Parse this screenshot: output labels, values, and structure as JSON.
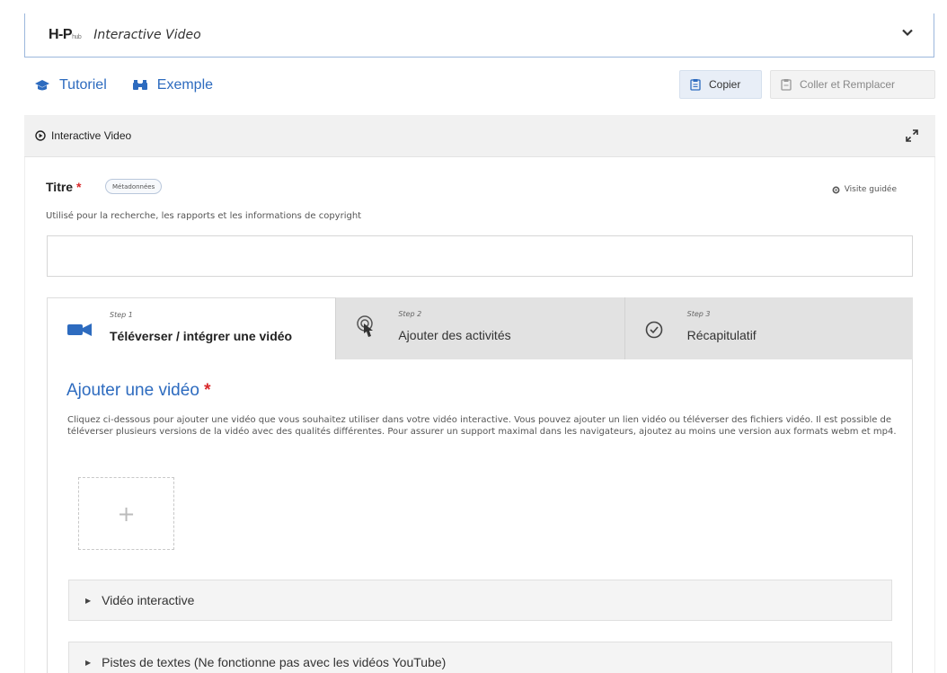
{
  "library": {
    "logo_main": "H-P",
    "logo_sub": "hub",
    "name": "Interactive Video"
  },
  "links": {
    "tutorial": "Tutoriel",
    "example": "Exemple"
  },
  "toolbar": {
    "copy_label": "Copier",
    "paste_label": "Coller et Remplacer"
  },
  "section": {
    "title": "Interactive Video"
  },
  "titre": {
    "label": "Titre",
    "required_mark": "*",
    "metadata_button": "Métadonnées",
    "guided_tour": "Visite guidée",
    "description": "Utilisé pour la recherche, les rapports et les informations de copyright",
    "value": ""
  },
  "steps": [
    {
      "num": "Step 1",
      "label": "Téléverser / intégrer une vidéo",
      "icon": "video-camera-icon",
      "active": true
    },
    {
      "num": "Step 2",
      "label": "Ajouter des activités",
      "icon": "touch-icon",
      "active": false
    },
    {
      "num": "Step 3",
      "label": "Récapitulatif",
      "icon": "check-circle-icon",
      "active": false
    }
  ],
  "add_video": {
    "title": "Ajouter une vidéo",
    "required_mark": "*",
    "description": "Cliquez ci-dessous pour ajouter une vidéo que vous souhaitez utiliser dans votre vidéo interactive. Vous pouvez ajouter un lien vidéo ou téléverser des fichiers vidéo. Il est possible de téléverser plusieurs versions de la vidéo avec des qualités différentes. Pour assurer un support maximal dans les navigateurs, ajoutez au moins une version aux formats webm et mp4.",
    "add_symbol": "+"
  },
  "accordions": [
    {
      "label": "Vidéo interactive"
    },
    {
      "label": "Pistes de textes (Ne fonctionne pas avec les vidéos YouTube)"
    }
  ],
  "colors": {
    "link_blue": "#2d6bbf",
    "required_red": "#d9282a",
    "step_inactive_bg": "#e2e2e2"
  }
}
